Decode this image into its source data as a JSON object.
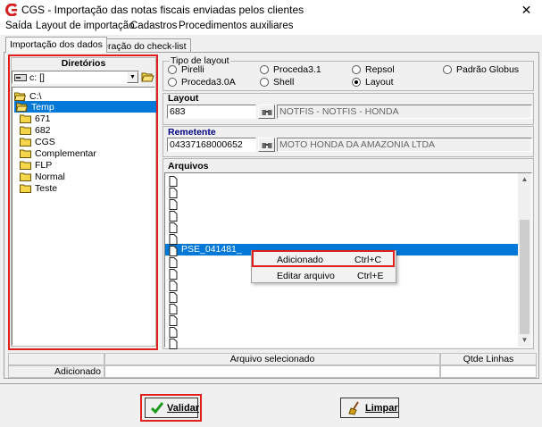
{
  "window": {
    "title": "CGS - Importação das notas fiscais enviadas pelos clientes",
    "close_glyph": "✕"
  },
  "menu": [
    "Saída",
    "Layout de importação",
    "Cadastros",
    "Procedimentos auxiliares"
  ],
  "tabs": [
    "Importação dos dados",
    "Geração do check-list"
  ],
  "directories": {
    "title": "Diretórios",
    "drive": "c: []",
    "tree": [
      "C:\\",
      "Temp",
      "671",
      "682",
      "CGS",
      "Complementar",
      "FLP",
      "Normal",
      "Teste"
    ]
  },
  "layout_type": {
    "title": "Tipo de layout",
    "options": [
      "Pirelli",
      "Proceda3.1",
      "Repsol",
      "Padrão Globus",
      "Proceda3.0A",
      "Shell",
      "Layout"
    ],
    "selected": "Layout"
  },
  "layout": {
    "title": "Layout",
    "code": "683",
    "description": "NOTFIS - NOTFIS - HONDA"
  },
  "remetente": {
    "title": "Remetente",
    "code": "04337168000652",
    "description": "MOTO HONDA DA AMAZONIA LTDA"
  },
  "arquivos": {
    "title": "Arquivos",
    "selected_file": "PSE_041481_"
  },
  "context_menu": [
    {
      "label": "Adicionado",
      "shortcut": "Ctrl+C"
    },
    {
      "label": "Editar arquivo",
      "shortcut": "Ctrl+E"
    }
  ],
  "status": {
    "col_file": "Arquivo selecionado",
    "col_lines": "Qtde Linhas",
    "row_label": "Adicionado"
  },
  "buttons": {
    "validar": "Validar",
    "limpar": "Limpar"
  },
  "colors": {
    "selection": "#0078d7",
    "highlight_box": "#e0201e",
    "group_title": "#000080"
  }
}
